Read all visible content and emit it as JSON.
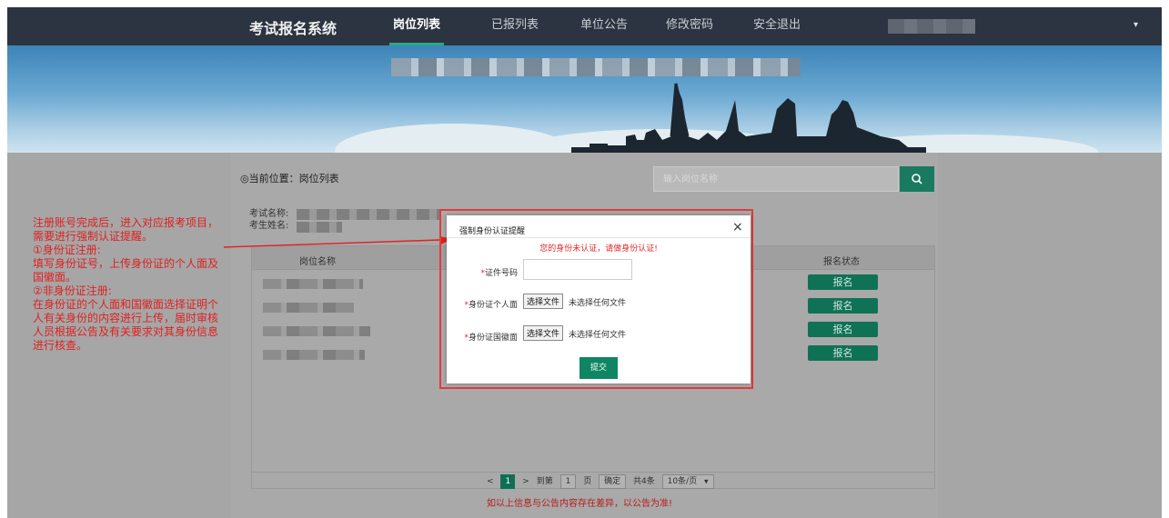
{
  "nav": {
    "brand": "考试报名系统",
    "items": [
      {
        "label": "岗位列表",
        "active": true
      },
      {
        "label": "已报列表",
        "active": false
      },
      {
        "label": "单位公告",
        "active": false
      },
      {
        "label": "修改密码",
        "active": false
      },
      {
        "label": "安全退出",
        "active": false
      }
    ],
    "user_caret": "▾"
  },
  "breadcrumb": "◎当前位置：岗位列表",
  "search": {
    "placeholder": "输入岗位名称",
    "icon": "search-icon"
  },
  "info": {
    "exam_label": "考试名称:",
    "student_label": "考生姓名:"
  },
  "table": {
    "headers": {
      "position_name": "岗位名称",
      "status": "报名状态"
    },
    "rows": [
      {
        "action": "报名"
      },
      {
        "action": "报名"
      },
      {
        "action": "报名"
      },
      {
        "action": "报名"
      }
    ]
  },
  "pager": {
    "prev": "<",
    "current": "1",
    "next": ">",
    "goto_label": "到第",
    "page_input": "1",
    "page_unit": "页",
    "confirm": "确定",
    "total": "共4条",
    "per_page": "10条/页"
  },
  "notice": "如以上信息与公告内容存在差异，以公告为准!",
  "annotation": {
    "lines": [
      "注册账号完成后，进入对应报考项目，需要进行强制认证提醒。",
      "①身份证注册:",
      "填写身份证号，上传身份证的个人面及国徽面。",
      "②非身份证注册:",
      "在身份证的个人面和国徽面选择证明个人有关身份的内容进行上传，届时审核人员根据公告及有关要求对其身份信息进行核查。"
    ]
  },
  "modal": {
    "title": "强制身份认证提醒",
    "close": "×",
    "warning": "您的身份未认证，请做身份认证!",
    "id_label": "证件号码",
    "front_label": "身份证个人面",
    "back_label": "身份证国徽面",
    "required_mark": "*",
    "choose_file": "选择文件",
    "no_file": "未选择任何文件",
    "submit": "提交"
  },
  "colors": {
    "nav_bg": "#2b3440",
    "accent": "#197a60",
    "warning": "#e21f1f"
  }
}
